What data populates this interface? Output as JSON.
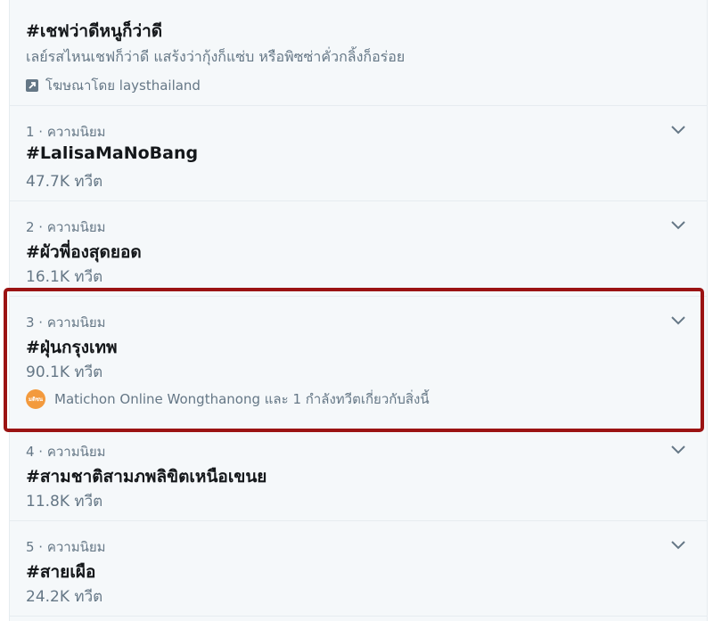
{
  "promoted": {
    "topic": "#เชฟว่าดีหนูก็ว่าดี",
    "description": "เลย์รสไหนเชฟก็ว่าดี แสร้งว่ากุ้งก็แซ่บ หรือพิซซ่าคั่วกลิ้งก็อร่อย",
    "promoted_by": "โฆษณาโดย laysthailand",
    "icon": "promoted-arrow-icon"
  },
  "trends": [
    {
      "meta": "1 · ความนิยม",
      "topic": "#LalisaMaNoBang",
      "count": "47.7K ทวีต"
    },
    {
      "meta": "2 · ความนิยม",
      "topic": "#ผัวพี่องสุดยอด",
      "count": "16.1K ทวีต"
    },
    {
      "meta": "3 · ความนิยม",
      "topic": "#ฝุ่นกรุงเทพ",
      "count": "90.1K ทวีต",
      "mentions": "Matichon Online Wongthanong และ 1 กำลังทวีตเกี่ยวกับสิ่งนี้",
      "avatar_label": "มติชน"
    },
    {
      "meta": "4 · ความนิยม",
      "topic": "#สามชาติสามภพลิขิตเหนือเขนย",
      "count": "11.8K ทวีต"
    },
    {
      "meta": "5 · ความนิยม",
      "topic": "#สายเผือ",
      "count": "24.2K ทวีต"
    }
  ],
  "colors": {
    "highlight_border": "#9b1313",
    "secondary_text": "#657786",
    "primary_text": "#14171a",
    "avatar": "#f39a3d"
  }
}
